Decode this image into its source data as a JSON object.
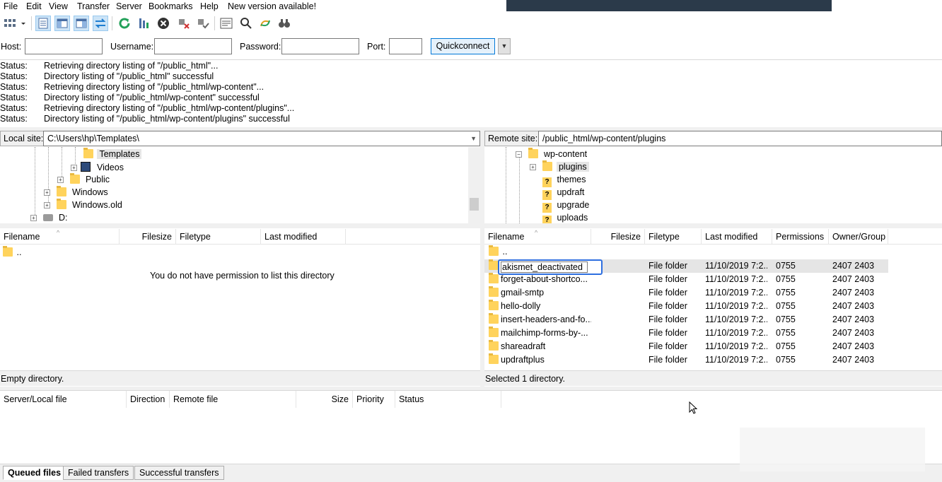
{
  "menu": [
    "File",
    "Edit",
    "View",
    "Transfer",
    "Server",
    "Bookmarks",
    "Help",
    "New version available!"
  ],
  "quickconnect": {
    "host_label": "Host:",
    "host_value": "",
    "username_label": "Username:",
    "username_value": "",
    "password_label": "Password:",
    "password_value": "",
    "port_label": "Port:",
    "port_value": "",
    "button": "Quickconnect"
  },
  "log": [
    {
      "k": "Status:",
      "v": "Retrieving directory listing of \"/public_html\"..."
    },
    {
      "k": "Status:",
      "v": "Directory listing of \"/public_html\" successful"
    },
    {
      "k": "Status:",
      "v": "Retrieving directory listing of \"/public_html/wp-content\"..."
    },
    {
      "k": "Status:",
      "v": "Directory listing of \"/public_html/wp-content\" successful"
    },
    {
      "k": "Status:",
      "v": "Retrieving directory listing of \"/public_html/wp-content/plugins\"..."
    },
    {
      "k": "Status:",
      "v": "Directory listing of \"/public_html/wp-content/plugins\" successful"
    }
  ],
  "local": {
    "site_label": "Local site:",
    "path": "C:\\Users\\hp\\Templates\\",
    "tree": [
      "Templates",
      "Videos",
      "Public",
      "Windows",
      "Windows.old",
      "D:"
    ],
    "headers": [
      "Filename",
      "Filesize",
      "Filetype",
      "Last modified"
    ],
    "up_dir": "..",
    "message": "You do not have permission to list this directory",
    "status": "Empty directory."
  },
  "remote": {
    "site_label": "Remote site:",
    "path": "/public_html/wp-content/plugins",
    "tree": [
      "wp-content",
      "plugins",
      "themes",
      "updraft",
      "upgrade",
      "uploads"
    ],
    "headers": [
      "Filename",
      "Filesize",
      "Filetype",
      "Last modified",
      "Permissions",
      "Owner/Group"
    ],
    "up_dir": "..",
    "rename_value": "akismet_deactivated",
    "files": [
      {
        "name": "",
        "type": "File folder",
        "modified": "11/10/2019 7:2...",
        "perm": "0755",
        "owner": "2407 2403"
      },
      {
        "name": "forget-about-shortco...",
        "type": "File folder",
        "modified": "11/10/2019 7:2...",
        "perm": "0755",
        "owner": "2407 2403"
      },
      {
        "name": "gmail-smtp",
        "type": "File folder",
        "modified": "11/10/2019 7:2...",
        "perm": "0755",
        "owner": "2407 2403"
      },
      {
        "name": "hello-dolly",
        "type": "File folder",
        "modified": "11/10/2019 7:2...",
        "perm": "0755",
        "owner": "2407 2403"
      },
      {
        "name": "insert-headers-and-fo...",
        "type": "File folder",
        "modified": "11/10/2019 7:2...",
        "perm": "0755",
        "owner": "2407 2403"
      },
      {
        "name": "mailchimp-forms-by-...",
        "type": "File folder",
        "modified": "11/10/2019 7:2...",
        "perm": "0755",
        "owner": "2407 2403"
      },
      {
        "name": "shareadraft",
        "type": "File folder",
        "modified": "11/10/2019 7:2...",
        "perm": "0755",
        "owner": "2407 2403"
      },
      {
        "name": "updraftplus",
        "type": "File folder",
        "modified": "11/10/2019 7:2...",
        "perm": "0755",
        "owner": "2407 2403"
      }
    ],
    "status": "Selected 1 directory."
  },
  "queue": {
    "headers": [
      "Server/Local file",
      "Direction",
      "Remote file",
      "Size",
      "Priority",
      "Status"
    ],
    "tabs": [
      "Queued files",
      "Failed transfers",
      "Successful transfers"
    ]
  },
  "colors": {
    "accent": "#2e6fe0",
    "folder": "#ffd35c",
    "selected_row": "#e5e5e5"
  }
}
